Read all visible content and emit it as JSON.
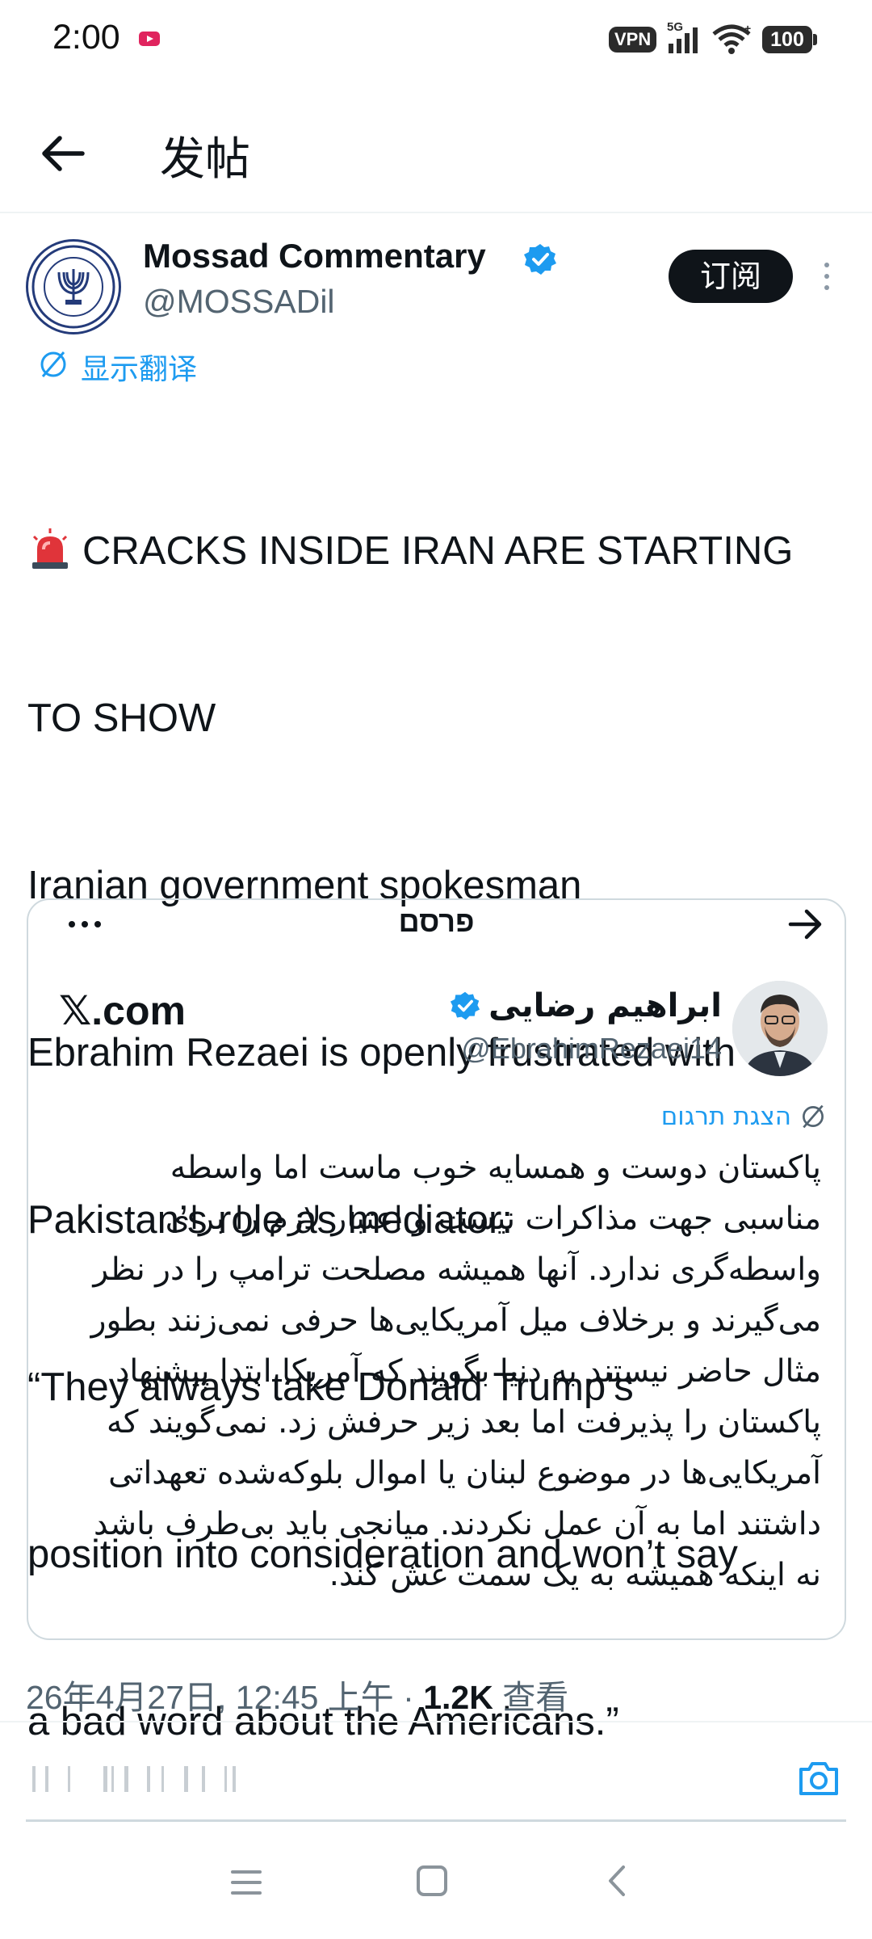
{
  "status_bar": {
    "time": "2:00",
    "vpn": "VPN",
    "network": "5G",
    "battery": "100"
  },
  "header": {
    "title": "发帖"
  },
  "post": {
    "display_name": "Mossad Commentary",
    "handle": "@MOSSADil",
    "subscribe_label": "订阅",
    "show_translation": "显示翻译",
    "body_lines": [
      "CRACKS INSIDE IRAN ARE STARTING",
      "TO SHOW",
      "Iranian government spokesman",
      "Ebrahim Rezaei is openly frustrated with",
      "Pakistan’s role as mediator:",
      "“They always take Donald Trump’s",
      "position into consideration and won’t say",
      "a bad word about the Americans.”"
    ],
    "timestamp": "26年4月27日, 12:45 上午 · ",
    "views_count": "1.2K",
    "views_label": " 查看"
  },
  "embed": {
    "header_title": "פרסם",
    "site_logo": "𝕏.com",
    "author_name": "ابراهیم رضایی",
    "author_handle": "@EbrahimRezaei14",
    "translate_label": "הצגת תרגום",
    "body_lines": [
      "پاکستان دوست و همسایه خوب ماست اما واسطه",
      "مناسبی جهت مذاکرات نیست و اعتبار لازم را برای",
      "واسطه‌گری ندارد. آنها همیشه مصلحت ترامپ را در نظر",
      "می‌گیرند و برخلاف میل آمریکایی‌ها حرفی نمی‌زنند بطور",
      "مثال حاضر نیستند به دنیا بگویند که آمریکا ابتدا پیشنهاد",
      "پاکستان را پذیرفت اما بعد زیر حرفش زد. نمی‌گویند که",
      "آمریکایی‌ها در موضوع لبنان یا اموال بلوکه‌شده تعهداتی",
      "داشتند اما به آن عمل نکردند. میانجی باید بی‌طرف باشد",
      "نه اینکه همیشه به یک سمت غش کند."
    ]
  },
  "colors": {
    "accent": "#1d9bf0",
    "text": "#0f1419",
    "muted": "#536471"
  }
}
